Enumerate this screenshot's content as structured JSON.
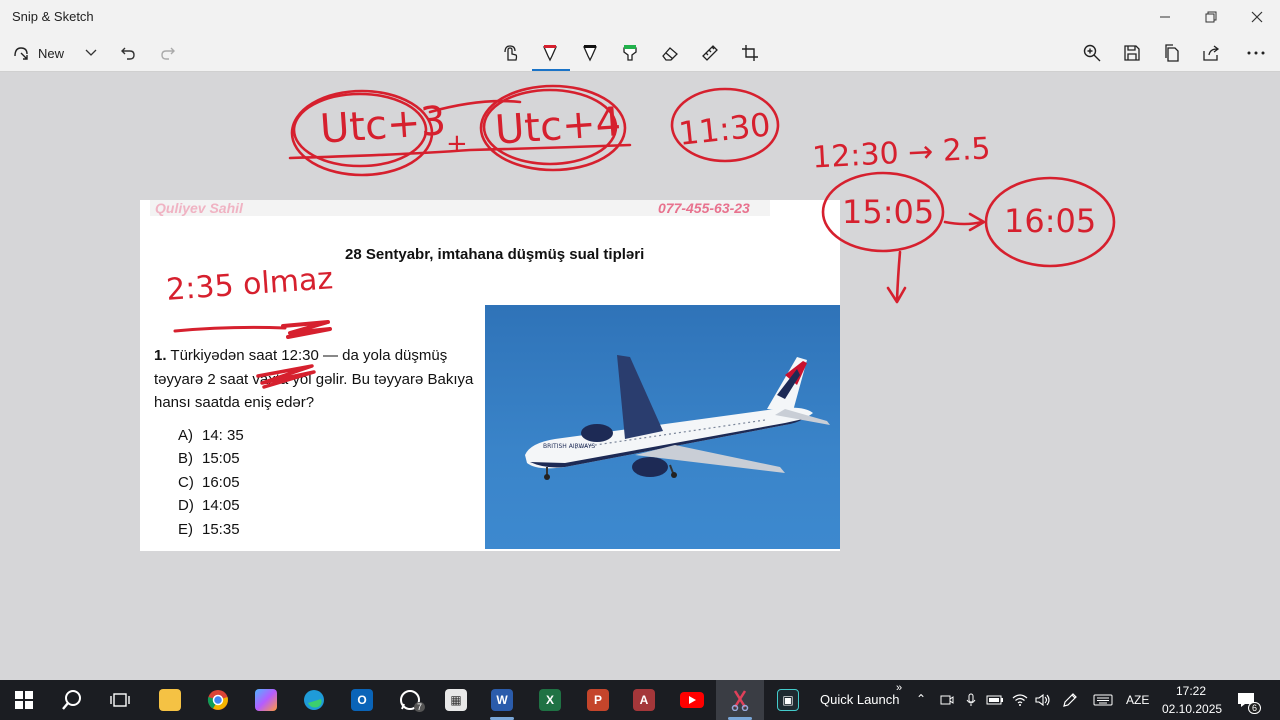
{
  "window": {
    "title": "Snip & Sketch",
    "minimize_icon": "minimize-icon",
    "maximize_icon": "restore-icon",
    "close_icon": "close-icon"
  },
  "toolbar": {
    "new_label": "New",
    "tools": [
      "touch-writing-icon",
      "ballpoint-pen-icon",
      "pencil-icon",
      "highlighter-icon",
      "eraser-icon",
      "ruler-icon",
      "crop-icon"
    ],
    "right_tools": [
      "zoom-icon",
      "save-icon",
      "copy-icon",
      "share-icon",
      "more-icon"
    ],
    "pen_color": "#d6202e",
    "highlighter_color": "#22b14c"
  },
  "document": {
    "watermark_name": "Quliyev Sahil",
    "watermark_phone": "077-455-63-23",
    "heading": "28 Sentyabr, imtahana düşmüş sual tipləri",
    "question_number": "1.",
    "question_text": " Türkiyədən saat 12:30 — da yola düşmüş təyyarə 2 saat vaxta yol gəlir. Bu təyyarə Bakıya hansı saatda eniş edər?",
    "options": [
      {
        "letter": "A)",
        "value": "14: 35"
      },
      {
        "letter": "B)",
        "value": "15:05"
      },
      {
        "letter": "C)",
        "value": "16:05"
      },
      {
        "letter": "D)",
        "value": "14:05"
      },
      {
        "letter": "E)",
        "value": "15:35"
      }
    ],
    "photo_caption": "BRITISH AIRWAYS"
  },
  "handwriting": {
    "utc3": "Utc+3",
    "utc4": "Utc+4",
    "time1": "11:30",
    "calc": "12:30 → 2.5",
    "answer1": "15:05",
    "answer2": "16:05",
    "note": "2:35 olmaz"
  },
  "taskbar": {
    "apps": [
      "windows-start-icon",
      "search-icon",
      "task-view-icon",
      "file-explorer-icon",
      "chrome-icon",
      "copilot-icon",
      "edge-icon",
      "outlook-icon",
      "whatsapp-icon",
      "store-icon",
      "word-icon",
      "excel-icon",
      "powerpoint-icon",
      "access-icon",
      "youtube-icon",
      "snip-sketch-icon",
      "app-icon"
    ],
    "whatsapp_badge": "7",
    "quick_launch": "Quick Launch",
    "language": "AZE",
    "time": "17:22",
    "date": "02.10.2025",
    "notification_count": "6"
  }
}
